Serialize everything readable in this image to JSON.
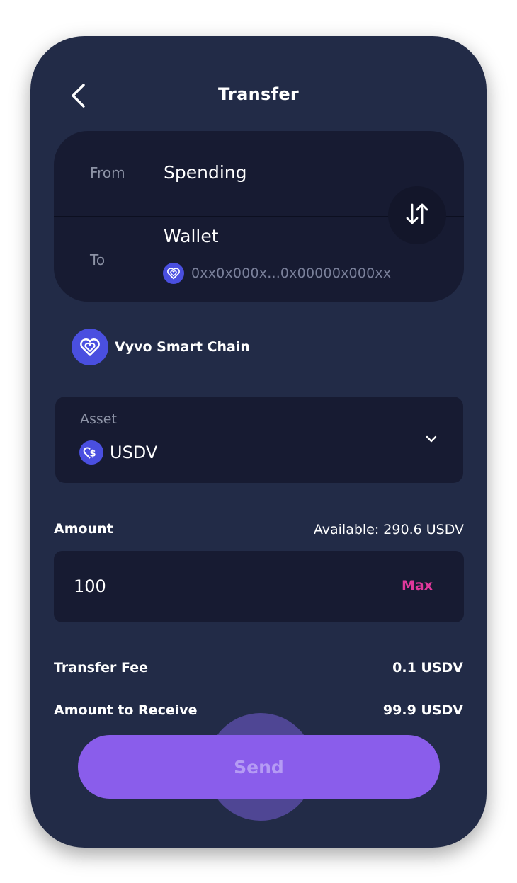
{
  "header": {
    "title": "Transfer"
  },
  "route": {
    "from_label": "From",
    "from_value": "Spending",
    "to_label": "To",
    "to_value": "Wallet",
    "to_address": "0xx0x000x...0x00000x000xx"
  },
  "chain": {
    "label": "Vyvo Smart Chain"
  },
  "asset": {
    "label": "Asset",
    "value": "USDV"
  },
  "amount": {
    "label": "Amount",
    "available": "Available: 290.6 USDV",
    "value": "100",
    "max_label": "Max"
  },
  "summary": {
    "fee_label": "Transfer Fee",
    "fee_value": "0.1 USDV",
    "receive_label": "Amount to Receive",
    "receive_value": "99.9 USDV"
  },
  "actions": {
    "send_label": "Send"
  },
  "colors": {
    "background": "#222b47",
    "card": "#171b32",
    "accent": "#8a5deb",
    "brand_icon": "#4a4fe0",
    "max_text": "#e0389b"
  },
  "icons": {
    "back": "chevron-left-icon",
    "swap": "swap-vertical-icon",
    "chain": "heart-logo-icon",
    "asset": "dollar-coin-icon",
    "dropdown": "chevron-down-icon"
  }
}
